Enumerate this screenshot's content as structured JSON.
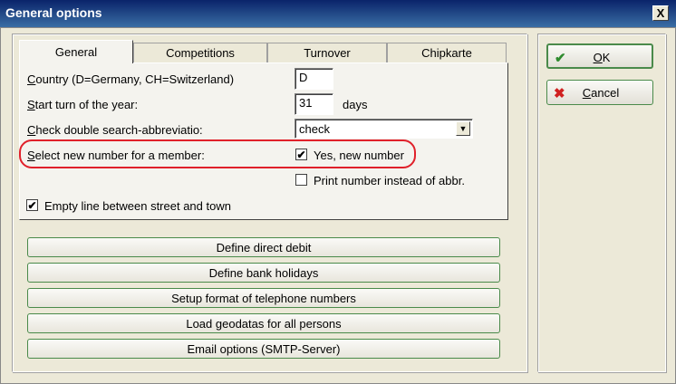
{
  "window": {
    "title": "General options",
    "close_symbol": "X"
  },
  "tabs": [
    {
      "label": "General",
      "active": true
    },
    {
      "label": "Competitions",
      "active": false
    },
    {
      "label": "Turnover",
      "active": false
    },
    {
      "label": "Chipkarte",
      "active": false
    }
  ],
  "general": {
    "country": {
      "hotkey": "C",
      "rest": "ountry (D=Germany, CH=Switzerland)",
      "value": "D"
    },
    "start_turn": {
      "hotkey": "S",
      "rest": "tart turn of the year:",
      "value": "31",
      "unit": "days"
    },
    "double_search": {
      "hotkey": "C",
      "rest": "heck double search-abbreviatio:",
      "selected": "check"
    },
    "new_number": {
      "hotkey": "S",
      "rest": "elect new number for a member:",
      "checkbox_label": "Yes, new number",
      "checked": true
    },
    "print_number": {
      "label": "Print number instead of abbr.",
      "checked": false
    },
    "empty_line": {
      "label": "Empty line between street and town",
      "checked": true
    }
  },
  "action_buttons": [
    "Define direct debit",
    "Define bank holidays",
    "Setup format of telephone numbers",
    "Load geodatas for all persons",
    "Email options (SMTP-Server)"
  ],
  "side_buttons": {
    "ok": {
      "hotkey": "O",
      "rest": "K",
      "icon": "check-icon",
      "icon_color": "#2e8b2e"
    },
    "cancel": {
      "hotkey": "C",
      "rest": "ancel",
      "icon": "x-icon",
      "icon_color": "#d02020"
    }
  },
  "colors": {
    "title_bar": "#0a246a",
    "highlight_ring": "#e0202a",
    "button_border": "#4a8a4a"
  }
}
